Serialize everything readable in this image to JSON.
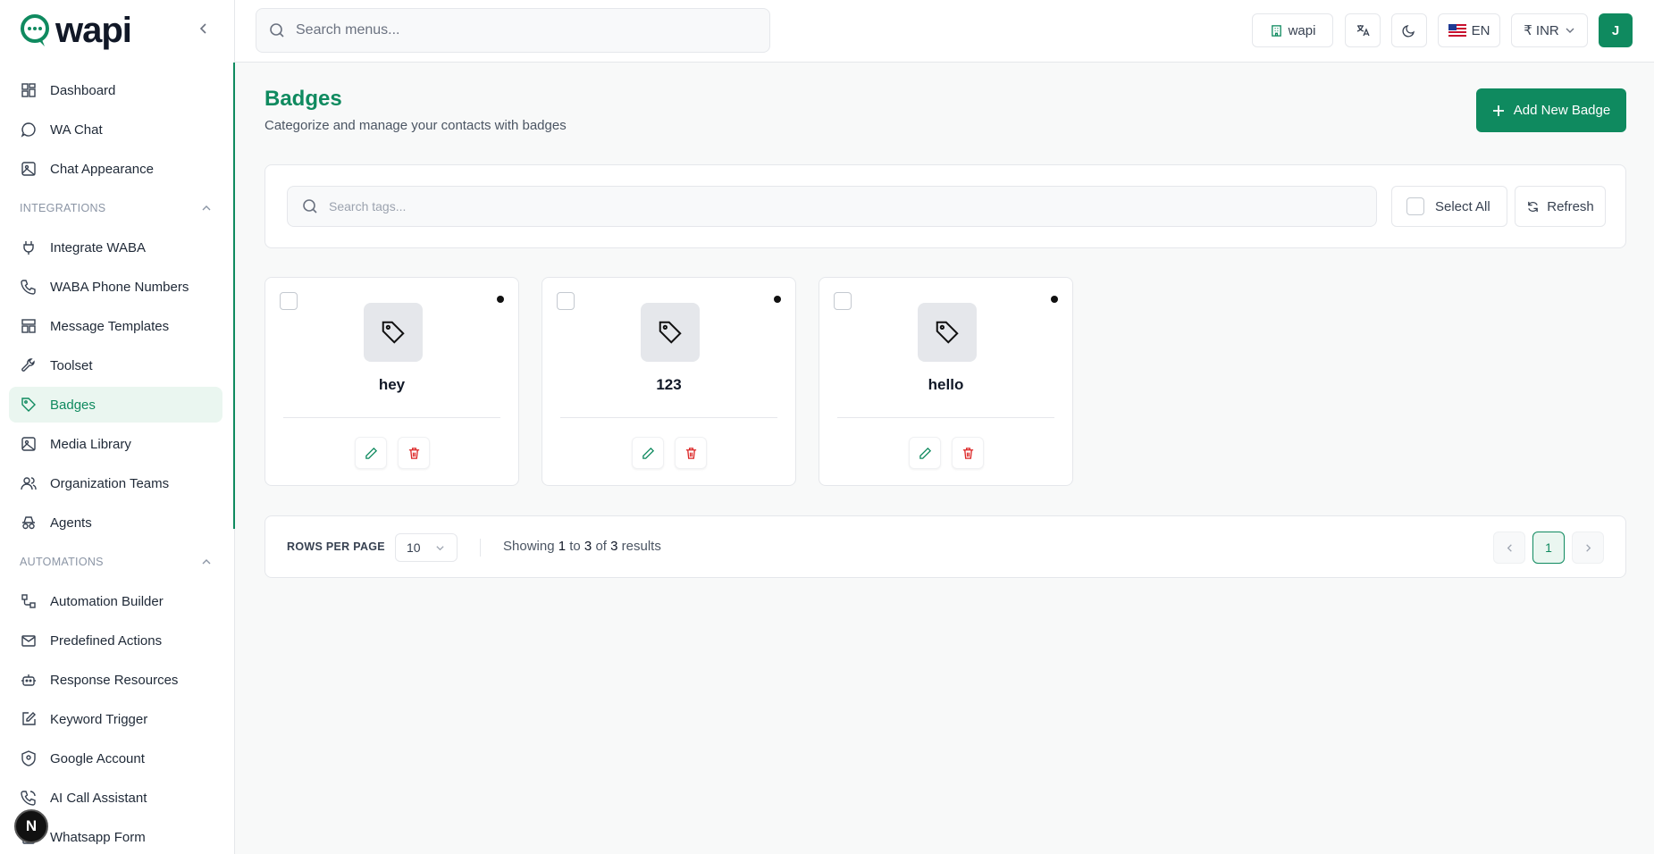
{
  "app": {
    "name": "wapi"
  },
  "sidebar": {
    "items_top": [
      {
        "label": "Dashboard",
        "icon": "dashboard-icon"
      },
      {
        "label": "WA Chat",
        "icon": "chat-bubble-icon"
      },
      {
        "label": "Chat Appearance",
        "icon": "image-icon"
      }
    ],
    "section_integrations": "INTEGRATIONS",
    "items_integrations": [
      {
        "label": "Integrate WABA",
        "icon": "plug-icon"
      },
      {
        "label": "WABA Phone Numbers",
        "icon": "phone-icon"
      },
      {
        "label": "Message Templates",
        "icon": "template-icon"
      },
      {
        "label": "Toolset",
        "icon": "wrench-icon"
      },
      {
        "label": "Badges",
        "icon": "tag-icon",
        "active": true
      },
      {
        "label": "Media Library",
        "icon": "image-icon"
      },
      {
        "label": "Organization Teams",
        "icon": "users-icon"
      },
      {
        "label": "Agents",
        "icon": "agent-icon"
      }
    ],
    "section_automations": "AUTOMATIONS",
    "items_automations": [
      {
        "label": "Automation Builder",
        "icon": "workflow-icon"
      },
      {
        "label": "Predefined Actions",
        "icon": "mail-icon"
      },
      {
        "label": "Response Resources",
        "icon": "bot-icon"
      },
      {
        "label": "Keyword Trigger",
        "icon": "edit-square-icon"
      },
      {
        "label": "Google Account",
        "icon": "shield-icon"
      },
      {
        "label": "AI Call Assistant",
        "icon": "phone-call-icon"
      },
      {
        "label": "Whatsapp Form",
        "icon": "form-icon"
      }
    ],
    "n_badge": "N"
  },
  "topbar": {
    "search_placeholder": "Search menus...",
    "workspace": "wapi",
    "language": "EN",
    "currency": "₹ INR",
    "avatar": "J"
  },
  "page": {
    "title": "Badges",
    "subtitle": "Categorize and manage your contacts with badges",
    "add_button": "Add New Badge"
  },
  "filters": {
    "search_placeholder": "Search tags...",
    "select_all": "Select All",
    "refresh": "Refresh"
  },
  "badges": [
    {
      "name": "hey"
    },
    {
      "name": "123"
    },
    {
      "name": "hello"
    }
  ],
  "pagination": {
    "rows_per_page_label": "ROWS PER PAGE",
    "rows_per_page": "10",
    "showing_prefix": "Showing",
    "from": "1",
    "to_word": "to",
    "to": "3",
    "of_word": "of",
    "total": "3",
    "results_word": "results",
    "current_page": "1"
  },
  "colors": {
    "brand": "#0f8a5f",
    "danger": "#dc2626"
  }
}
